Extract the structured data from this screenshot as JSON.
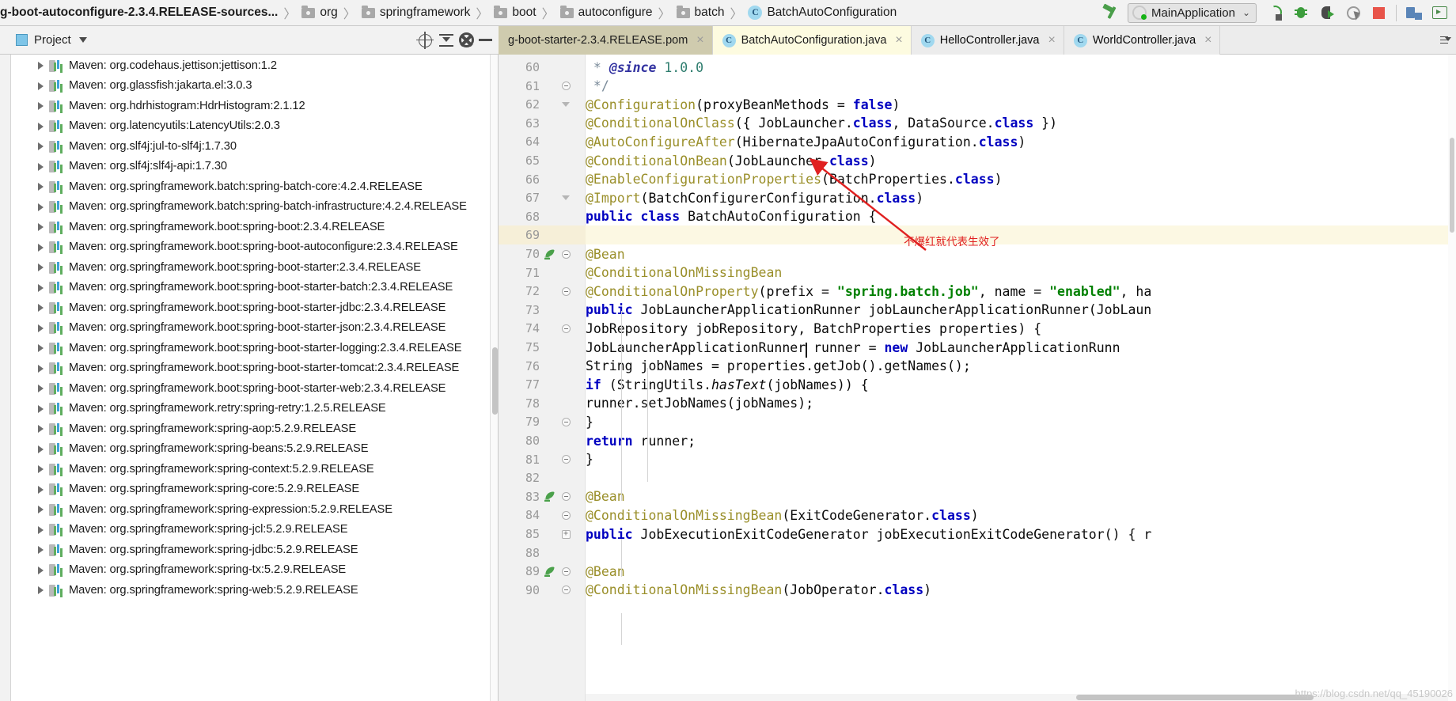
{
  "breadcrumb": {
    "items": [
      {
        "label": "g-boot-autoconfigure-2.3.4.RELEASE-sources...",
        "icon": "none",
        "bold": true
      },
      {
        "label": "org",
        "icon": "folder-icon"
      },
      {
        "label": "springframework",
        "icon": "folder-icon"
      },
      {
        "label": "boot",
        "icon": "folder-icon"
      },
      {
        "label": "autoconfigure",
        "icon": "folder-icon"
      },
      {
        "label": "batch",
        "icon": "folder-icon"
      },
      {
        "label": "BatchAutoConfiguration",
        "icon": "class-icon",
        "badge": "C"
      }
    ],
    "separator": "〉"
  },
  "toolbar": {
    "build_icon": "hammer-icon",
    "run_config": {
      "name": "MainApplication",
      "icon": "spring-boot-icon",
      "chevron": "⌄"
    },
    "run_icon": "run-icon",
    "debug_icon": "debug-bug-icon",
    "run_with_coverage_icon": "coverage-icon",
    "profile_icon": "profiler-icon",
    "stop_icon": "stop-icon",
    "project_structure_icon": "project-structure-icon",
    "terminal_icon": "terminal-icon"
  },
  "project_panel": {
    "title": "Project",
    "title_icon": "project-window-icon",
    "dropdown_icon": "chevron-down-icon",
    "locate_icon": "scroll-from-source-icon",
    "collapse_icon": "collapse-all-icon",
    "settings_icon": "gear-icon",
    "hide_icon": "hide-icon",
    "items": [
      "Maven: org.codehaus.jettison:jettison:1.2",
      "Maven: org.glassfish:jakarta.el:3.0.3",
      "Maven: org.hdrhistogram:HdrHistogram:2.1.12",
      "Maven: org.latencyutils:LatencyUtils:2.0.3",
      "Maven: org.slf4j:jul-to-slf4j:1.7.30",
      "Maven: org.slf4j:slf4j-api:1.7.30",
      "Maven: org.springframework.batch:spring-batch-core:4.2.4.RELEASE",
      "Maven: org.springframework.batch:spring-batch-infrastructure:4.2.4.RELEASE",
      "Maven: org.springframework.boot:spring-boot:2.3.4.RELEASE",
      "Maven: org.springframework.boot:spring-boot-autoconfigure:2.3.4.RELEASE",
      "Maven: org.springframework.boot:spring-boot-starter:2.3.4.RELEASE",
      "Maven: org.springframework.boot:spring-boot-starter-batch:2.3.4.RELEASE",
      "Maven: org.springframework.boot:spring-boot-starter-jdbc:2.3.4.RELEASE",
      "Maven: org.springframework.boot:spring-boot-starter-json:2.3.4.RELEASE",
      "Maven: org.springframework.boot:spring-boot-starter-logging:2.3.4.RELEASE",
      "Maven: org.springframework.boot:spring-boot-starter-tomcat:2.3.4.RELEASE",
      "Maven: org.springframework.boot:spring-boot-starter-web:2.3.4.RELEASE",
      "Maven: org.springframework.retry:spring-retry:1.2.5.RELEASE",
      "Maven: org.springframework:spring-aop:5.2.9.RELEASE",
      "Maven: org.springframework:spring-beans:5.2.9.RELEASE",
      "Maven: org.springframework:spring-context:5.2.9.RELEASE",
      "Maven: org.springframework:spring-core:5.2.9.RELEASE",
      "Maven: org.springframework:spring-expression:5.2.9.RELEASE",
      "Maven: org.springframework:spring-jcl:5.2.9.RELEASE",
      "Maven: org.springframework:spring-jdbc:5.2.9.RELEASE",
      "Maven: org.springframework:spring-tx:5.2.9.RELEASE",
      "Maven: org.springframework:spring-web:5.2.9.RELEASE"
    ]
  },
  "editor_tabs": [
    {
      "label": "g-boot-starter-2.3.4.RELEASE.pom",
      "state": "inactive-pom",
      "icon": "none",
      "close": "×"
    },
    {
      "label": "BatchAutoConfiguration.java",
      "state": "active",
      "icon": "class-icon",
      "badge": "C",
      "close": "×"
    },
    {
      "label": "HelloController.java",
      "state": "inactive",
      "icon": "class-icon",
      "badge": "C",
      "close": "×"
    },
    {
      "label": "WorldController.java",
      "state": "inactive",
      "icon": "class-icon",
      "badge": "C",
      "close": "×"
    }
  ],
  "editor": {
    "highlighted_line": 69,
    "annotation": {
      "text": "不爆红就代表生效了",
      "color": "#e02020"
    },
    "watermark": "https://blog.csdn.net/qq_45190026",
    "lines": [
      {
        "n": "60",
        "gutter": "",
        "html": "  <span class=\"cmt\"> * </span><span class=\"cmt-tag\">@since</span><span class=\"cmt\"> </span><span class=\"cmt-num\">1.0.0</span>"
      },
      {
        "n": "61",
        "gutter": "circ",
        "html": "  <span class=\"cmt\"> */</span>"
      },
      {
        "n": "62",
        "gutter": "arrow",
        "html": "<span class=\"ann\">@Configuration</span><span class=\"plain\">(proxyBeanMethods = </span><span class=\"kw\">false</span><span class=\"plain\">)</span>"
      },
      {
        "n": "63",
        "gutter": "",
        "html": "<span class=\"ann\">@ConditionalOnClass</span><span class=\"plain\">({ JobLauncher.</span><span class=\"kw\">class</span><span class=\"plain\">, DataSource.</span><span class=\"kw\">class</span><span class=\"plain\"> })</span>"
      },
      {
        "n": "64",
        "gutter": "",
        "html": "<span class=\"ann\">@AutoConfigureAfter</span><span class=\"plain\">(HibernateJpaAutoConfiguration.</span><span class=\"kw\">class</span><span class=\"plain\">)</span>"
      },
      {
        "n": "65",
        "gutter": "",
        "html": "<span class=\"ann\">@ConditionalOnBean</span><span class=\"plain\">(JobLauncher.</span><span class=\"kw\">class</span><span class=\"plain\">)</span>"
      },
      {
        "n": "66",
        "gutter": "",
        "html": "<span class=\"ann\">@EnableConfigurationProperties</span><span class=\"plain\">(BatchProperties.</span><span class=\"kw\">class</span><span class=\"plain\">)</span>"
      },
      {
        "n": "67",
        "gutter": "arrow",
        "html": "<span class=\"ann\">@Import</span><span class=\"plain\">(BatchConfigurerConfiguration.</span><span class=\"kw\">class</span><span class=\"plain\">)</span>"
      },
      {
        "n": "68",
        "gutter": "",
        "html": "<span class=\"kw\">public class</span><span class=\"plain\"> BatchAutoConfiguration {</span>"
      },
      {
        "n": "69",
        "gutter": "",
        "html": "",
        "highlight": true
      },
      {
        "n": "70",
        "gutter": "circ",
        "bean": true,
        "html": "    <span class=\"ann\">@Bean</span>"
      },
      {
        "n": "71",
        "gutter": "",
        "html": "    <span class=\"ann\">@ConditionalOnMissingBean</span>"
      },
      {
        "n": "72",
        "gutter": "circ",
        "html": "    <span class=\"ann\">@ConditionalOnProperty</span><span class=\"plain\">(prefix = </span><span class=\"str\">\"spring.batch.job\"</span><span class=\"plain\">, name = </span><span class=\"str\">\"enabled\"</span><span class=\"plain\">, ha</span>"
      },
      {
        "n": "73",
        "gutter": "",
        "html": "    <span class=\"kw\">public</span><span class=\"plain\"> JobLauncherApplicationRunner jobLauncherApplicationRunner(JobLaun</span>"
      },
      {
        "n": "74",
        "gutter": "circ",
        "html": "            <span class=\"plain\">JobRepository jobRepository, BatchProperties properties) {</span>"
      },
      {
        "n": "75",
        "gutter": "",
        "html": "        <span class=\"plain\">JobLauncherApplicationRunner runner = </span><span class=\"kw\">new</span><span class=\"plain\"> JobLauncherApplicationRunn</span>"
      },
      {
        "n": "76",
        "gutter": "",
        "html": "        <span class=\"plain\">String jobNames = properties.getJob().getNames();</span>"
      },
      {
        "n": "77",
        "gutter": "",
        "html": "        <span class=\"kw\">if</span><span class=\"plain\"> (StringUtils.</span><span class=\"plain\" style=\"font-style:italic\">hasText</span><span class=\"plain\">(jobNames)) {</span>"
      },
      {
        "n": "78",
        "gutter": "",
        "html": "            <span class=\"plain\">runner.setJobNames(jobNames);</span>"
      },
      {
        "n": "79",
        "gutter": "circ",
        "html": "        <span class=\"plain\">}</span>"
      },
      {
        "n": "80",
        "gutter": "",
        "html": "        <span class=\"kw\">return</span><span class=\"plain\"> runner;</span>"
      },
      {
        "n": "81",
        "gutter": "circ",
        "html": "    <span class=\"plain\">}</span>"
      },
      {
        "n": "82",
        "gutter": "",
        "html": ""
      },
      {
        "n": "83",
        "gutter": "circ",
        "bean": true,
        "html": "    <span class=\"ann\">@Bean</span>"
      },
      {
        "n": "84",
        "gutter": "circ",
        "html": "    <span class=\"ann\">@ConditionalOnMissingBean</span><span class=\"plain\">(ExitCodeGenerator.</span><span class=\"kw\">class</span><span class=\"plain\">)</span>"
      },
      {
        "n": "85",
        "gutter": "plus",
        "html": "    <span class=\"kw\">public</span><span class=\"plain\"> JobExecutionExitCodeGenerator jobExecutionExitCodeGenerator() { </span><span class=\"plain\">r</span>"
      },
      {
        "n": "88",
        "gutter": "",
        "html": ""
      },
      {
        "n": "89",
        "gutter": "circ",
        "bean": true,
        "html": "    <span class=\"ann\">@Bean</span>"
      },
      {
        "n": "90",
        "gutter": "circ",
        "html": "    <span class=\"ann\">@ConditionalOnMissingBean</span><span class=\"plain\">(JobOperator.</span><span class=\"kw\">class</span><span class=\"plain\">)</span>"
      }
    ]
  }
}
